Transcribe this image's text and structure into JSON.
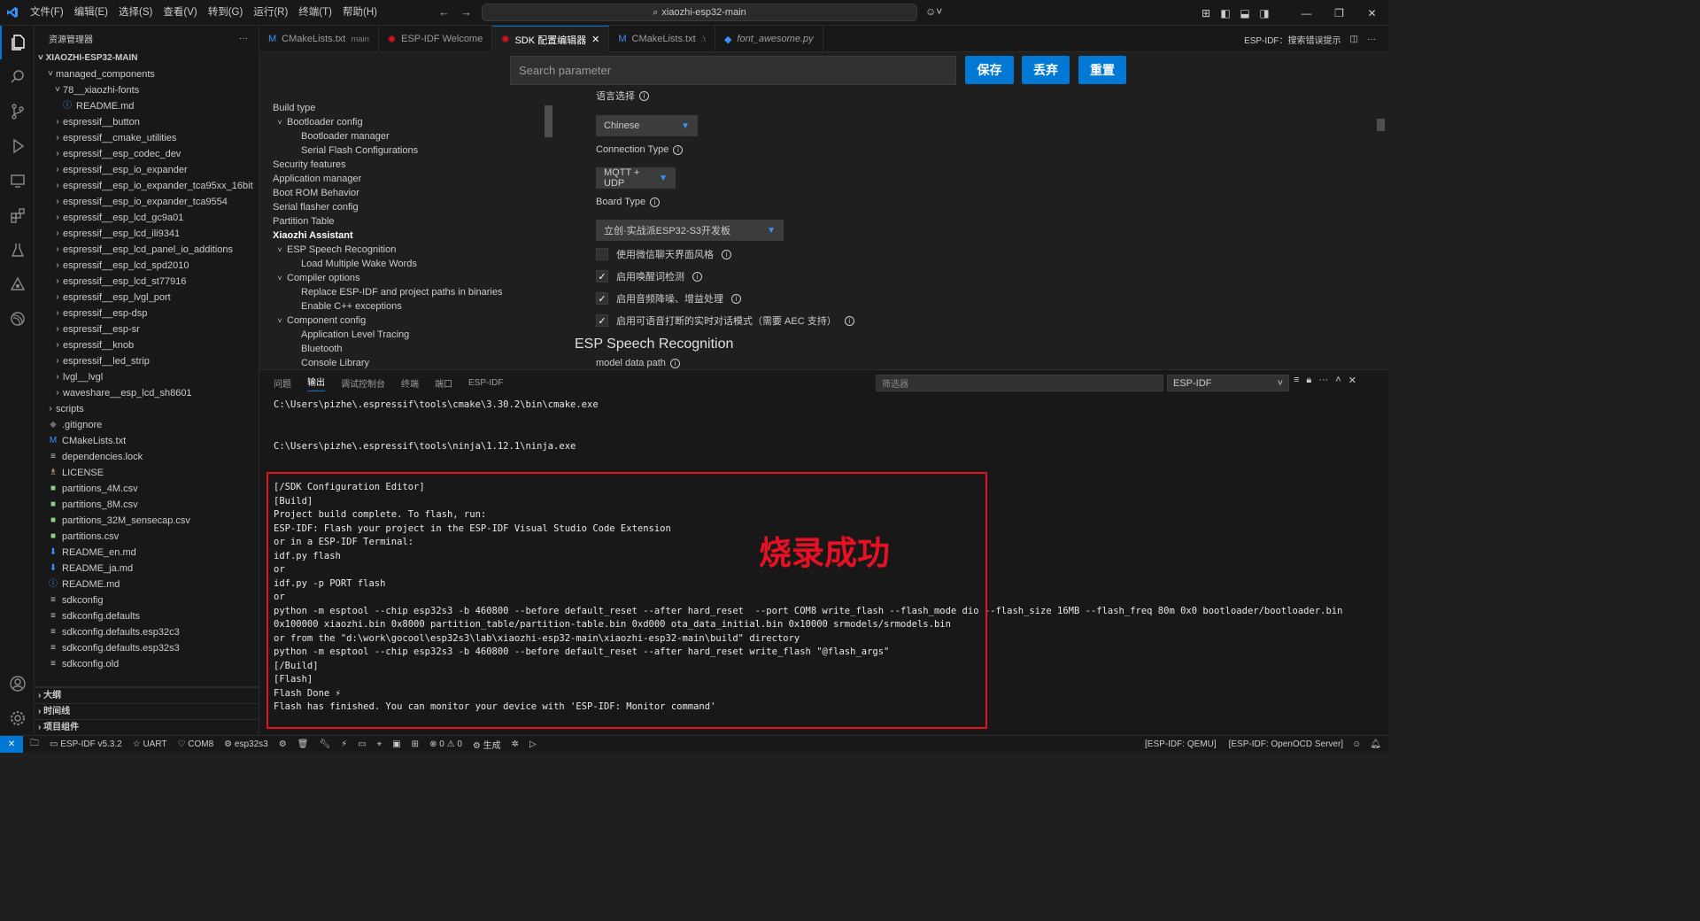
{
  "menu": [
    "文件(F)",
    "编辑(E)",
    "选择(S)",
    "查看(V)",
    "转到(G)",
    "运行(R)",
    "终端(T)",
    "帮助(H)"
  ],
  "command_center": "xiaozhi-esp32-main",
  "sidebar": {
    "title": "资源管理器",
    "root": "XIAOZHI-ESP32-MAIN",
    "items": [
      {
        "label": "managed_components",
        "depth": 1,
        "chev": "˅"
      },
      {
        "label": "78__xiaozhi-fonts",
        "depth": 2,
        "chev": "˅"
      },
      {
        "label": "README.md",
        "depth": 3,
        "icon": "ⓘ",
        "color": "#3794ff"
      },
      {
        "label": "espressif__button",
        "depth": 2,
        "chev": "›"
      },
      {
        "label": "espressif__cmake_utilities",
        "depth": 2,
        "chev": "›"
      },
      {
        "label": "espressif__esp_codec_dev",
        "depth": 2,
        "chev": "›"
      },
      {
        "label": "espressif__esp_io_expander",
        "depth": 2,
        "chev": "›"
      },
      {
        "label": "espressif__esp_io_expander_tca95xx_16bit",
        "depth": 2,
        "chev": "›"
      },
      {
        "label": "espressif__esp_io_expander_tca9554",
        "depth": 2,
        "chev": "›"
      },
      {
        "label": "espressif__esp_lcd_gc9a01",
        "depth": 2,
        "chev": "›"
      },
      {
        "label": "espressif__esp_lcd_ili9341",
        "depth": 2,
        "chev": "›"
      },
      {
        "label": "espressif__esp_lcd_panel_io_additions",
        "depth": 2,
        "chev": "›"
      },
      {
        "label": "espressif__esp_lcd_spd2010",
        "depth": 2,
        "chev": "›"
      },
      {
        "label": "espressif__esp_lcd_st77916",
        "depth": 2,
        "chev": "›"
      },
      {
        "label": "espressif__esp_lvgl_port",
        "depth": 2,
        "chev": "›"
      },
      {
        "label": "espressif__esp-dsp",
        "depth": 2,
        "chev": "›"
      },
      {
        "label": "espressif__esp-sr",
        "depth": 2,
        "chev": "›"
      },
      {
        "label": "espressif__knob",
        "depth": 2,
        "chev": "›"
      },
      {
        "label": "espressif__led_strip",
        "depth": 2,
        "chev": "›"
      },
      {
        "label": "lvgl__lvgl",
        "depth": 2,
        "chev": "›"
      },
      {
        "label": "waveshare__esp_lcd_sh8601",
        "depth": 2,
        "chev": "›"
      },
      {
        "label": "scripts",
        "depth": 1,
        "chev": "›"
      },
      {
        "label": ".gitignore",
        "depth": 1,
        "icon": "◆",
        "color": "#6b6b6b"
      },
      {
        "label": "CMakeLists.txt",
        "depth": 1,
        "icon": "M",
        "color": "#3794ff"
      },
      {
        "label": "dependencies.lock",
        "depth": 1,
        "icon": "≡",
        "color": "#cccccc"
      },
      {
        "label": "LICENSE",
        "depth": 1,
        "icon": "♗",
        "color": "#e2c08d"
      },
      {
        "label": "partitions_4M.csv",
        "depth": 1,
        "icon": "■",
        "color": "#89d185"
      },
      {
        "label": "partitions_8M.csv",
        "depth": 1,
        "icon": "■",
        "color": "#89d185"
      },
      {
        "label": "partitions_32M_sensecap.csv",
        "depth": 1,
        "icon": "■",
        "color": "#89d185"
      },
      {
        "label": "partitions.csv",
        "depth": 1,
        "icon": "■",
        "color": "#89d185"
      },
      {
        "label": "README_en.md",
        "depth": 1,
        "icon": "⬇",
        "color": "#3794ff"
      },
      {
        "label": "README_ja.md",
        "depth": 1,
        "icon": "⬇",
        "color": "#3794ff"
      },
      {
        "label": "README.md",
        "depth": 1,
        "icon": "ⓘ",
        "color": "#3794ff"
      },
      {
        "label": "sdkconfig",
        "depth": 1,
        "icon": "≡",
        "color": "#cccccc"
      },
      {
        "label": "sdkconfig.defaults",
        "depth": 1,
        "icon": "≡",
        "color": "#cccccc"
      },
      {
        "label": "sdkconfig.defaults.esp32c3",
        "depth": 1,
        "icon": "≡",
        "color": "#cccccc"
      },
      {
        "label": "sdkconfig.defaults.esp32s3",
        "depth": 1,
        "icon": "≡",
        "color": "#cccccc"
      },
      {
        "label": "sdkconfig.old",
        "depth": 1,
        "icon": "≡",
        "color": "#cccccc"
      }
    ],
    "sections": [
      "大纲",
      "时间线",
      "项目组件"
    ]
  },
  "tabs": [
    {
      "label": "CMakeLists.txt",
      "sub": "main",
      "icon": "M",
      "color": "#3794ff",
      "active": false
    },
    {
      "label": "ESP-IDF Welcome",
      "sub": "",
      "icon": "✺",
      "color": "#e81123",
      "active": false
    },
    {
      "label": "SDK 配置编辑器",
      "sub": "",
      "icon": "✺",
      "color": "#e81123",
      "active": true
    },
    {
      "label": "CMakeLists.txt",
      "sub": ".\\",
      "icon": "M",
      "color": "#3794ff",
      "active": false
    },
    {
      "label": "font_awesome.py",
      "sub": "",
      "icon": "◆",
      "color": "#3794ff",
      "active": false
    }
  ],
  "tab_right": "ESP-IDF：搜索错误提示",
  "editor": {
    "search_placeholder": "Search parameter",
    "buttons": {
      "save": "保存",
      "discard": "丢弃",
      "reset": "重置"
    },
    "tree": [
      {
        "label": "Build type",
        "depth": 0,
        "chev": ""
      },
      {
        "label": "Bootloader config",
        "depth": 0,
        "chev": "˅"
      },
      {
        "label": "Bootloader manager",
        "depth": 1,
        "chev": ""
      },
      {
        "label": "Serial Flash Configurations",
        "depth": 1,
        "chev": ""
      },
      {
        "label": "Security features",
        "depth": 0,
        "chev": ""
      },
      {
        "label": "Application manager",
        "depth": 0,
        "chev": ""
      },
      {
        "label": "Boot ROM Behavior",
        "depth": 0,
        "chev": ""
      },
      {
        "label": "Serial flasher config",
        "depth": 0,
        "chev": ""
      },
      {
        "label": "Partition Table",
        "depth": 0,
        "chev": ""
      },
      {
        "label": "Xiaozhi Assistant",
        "depth": 0,
        "chev": "",
        "bold": true
      },
      {
        "label": "ESP Speech Recognition",
        "depth": 0,
        "chev": "˅"
      },
      {
        "label": "Load Multiple Wake Words",
        "depth": 1,
        "chev": ""
      },
      {
        "label": "Compiler options",
        "depth": 0,
        "chev": "˅"
      },
      {
        "label": "Replace ESP-IDF and project paths in binaries",
        "depth": 1,
        "chev": ""
      },
      {
        "label": "Enable C++ exceptions",
        "depth": 1,
        "chev": ""
      },
      {
        "label": "Component config",
        "depth": 0,
        "chev": "˅"
      },
      {
        "label": "Application Level Tracing",
        "depth": 1,
        "chev": ""
      },
      {
        "label": "Bluetooth",
        "depth": 1,
        "chev": ""
      },
      {
        "label": "Console Library",
        "depth": 1,
        "chev": ""
      }
    ],
    "lang_label": "语言选择",
    "lang_value": "Chinese",
    "conn_label": "Connection Type",
    "conn_value": "MQTT + UDP",
    "board_label": "Board Type",
    "board_value": "立创·实战派ESP32-S3开发板",
    "checks": [
      {
        "label": "使用微信聊天界面风格",
        "checked": false
      },
      {
        "label": "启用唤醒词检测",
        "checked": true
      },
      {
        "label": "启用音频降噪、增益处理",
        "checked": true
      },
      {
        "label": "启用可语音打断的实时对话模式（需要 AEC 支持）",
        "checked": true
      }
    ],
    "section_heading": "ESP Speech Recognition",
    "model_label": "model data path"
  },
  "panel": {
    "tabs": [
      "问题",
      "输出",
      "调试控制台",
      "终端",
      "端口",
      "ESP-IDF"
    ],
    "active_tab": "输出",
    "filter_placeholder": "筛选器",
    "channel": "ESP-IDF",
    "lines": [
      "C:\\Users\\pizhe\\.espressif\\tools\\cmake\\3.30.2\\bin\\cmake.exe",
      "",
      "",
      "C:\\Users\\pizhe\\.espressif\\tools\\ninja\\1.12.1\\ninja.exe",
      "",
      "",
      "[/SDK Configuration Editor]",
      "[Build]",
      "Project build complete. To flash, run:",
      "ESP-IDF: Flash your project in the ESP-IDF Visual Studio Code Extension",
      "or in a ESP-IDF Terminal:",
      "idf.py flash",
      "or",
      "idf.py -p PORT flash",
      "or",
      "python -m esptool --chip esp32s3 -b 460800 --before default_reset --after hard_reset  --port COM8 write_flash --flash_mode dio --flash_size 16MB --flash_freq 80m 0x0 bootloader/bootloader.bin",
      "0x100000 xiaozhi.bin 0x8000 partition_table/partition-table.bin 0xd000 ota_data_initial.bin 0x10000 srmodels/srmodels.bin",
      "or from the \"d:\\work\\gocool\\esp32s3\\lab\\xiaozhi-esp32-main\\xiaozhi-esp32-main\\build\" directory",
      "python -m esptool --chip esp32s3 -b 460800 --before default_reset --after hard_reset write_flash \"@flash_args\"",
      "[/Build]",
      "[Flash]",
      "Flash Done ⚡",
      "Flash has finished. You can monitor your device with 'ESP-IDF: Monitor command'"
    ],
    "annotation": "烧录成功"
  },
  "status": {
    "idf": "ESP-IDF v5.3.2",
    "uart": "UART",
    "port": "COM8",
    "target": "esp32s3",
    "problems": "0",
    "warnings": "0",
    "build": "生成",
    "qemu": "[ESP-IDF: QEMU]",
    "openocd": "[ESP-IDF: OpenOCD Server]"
  }
}
